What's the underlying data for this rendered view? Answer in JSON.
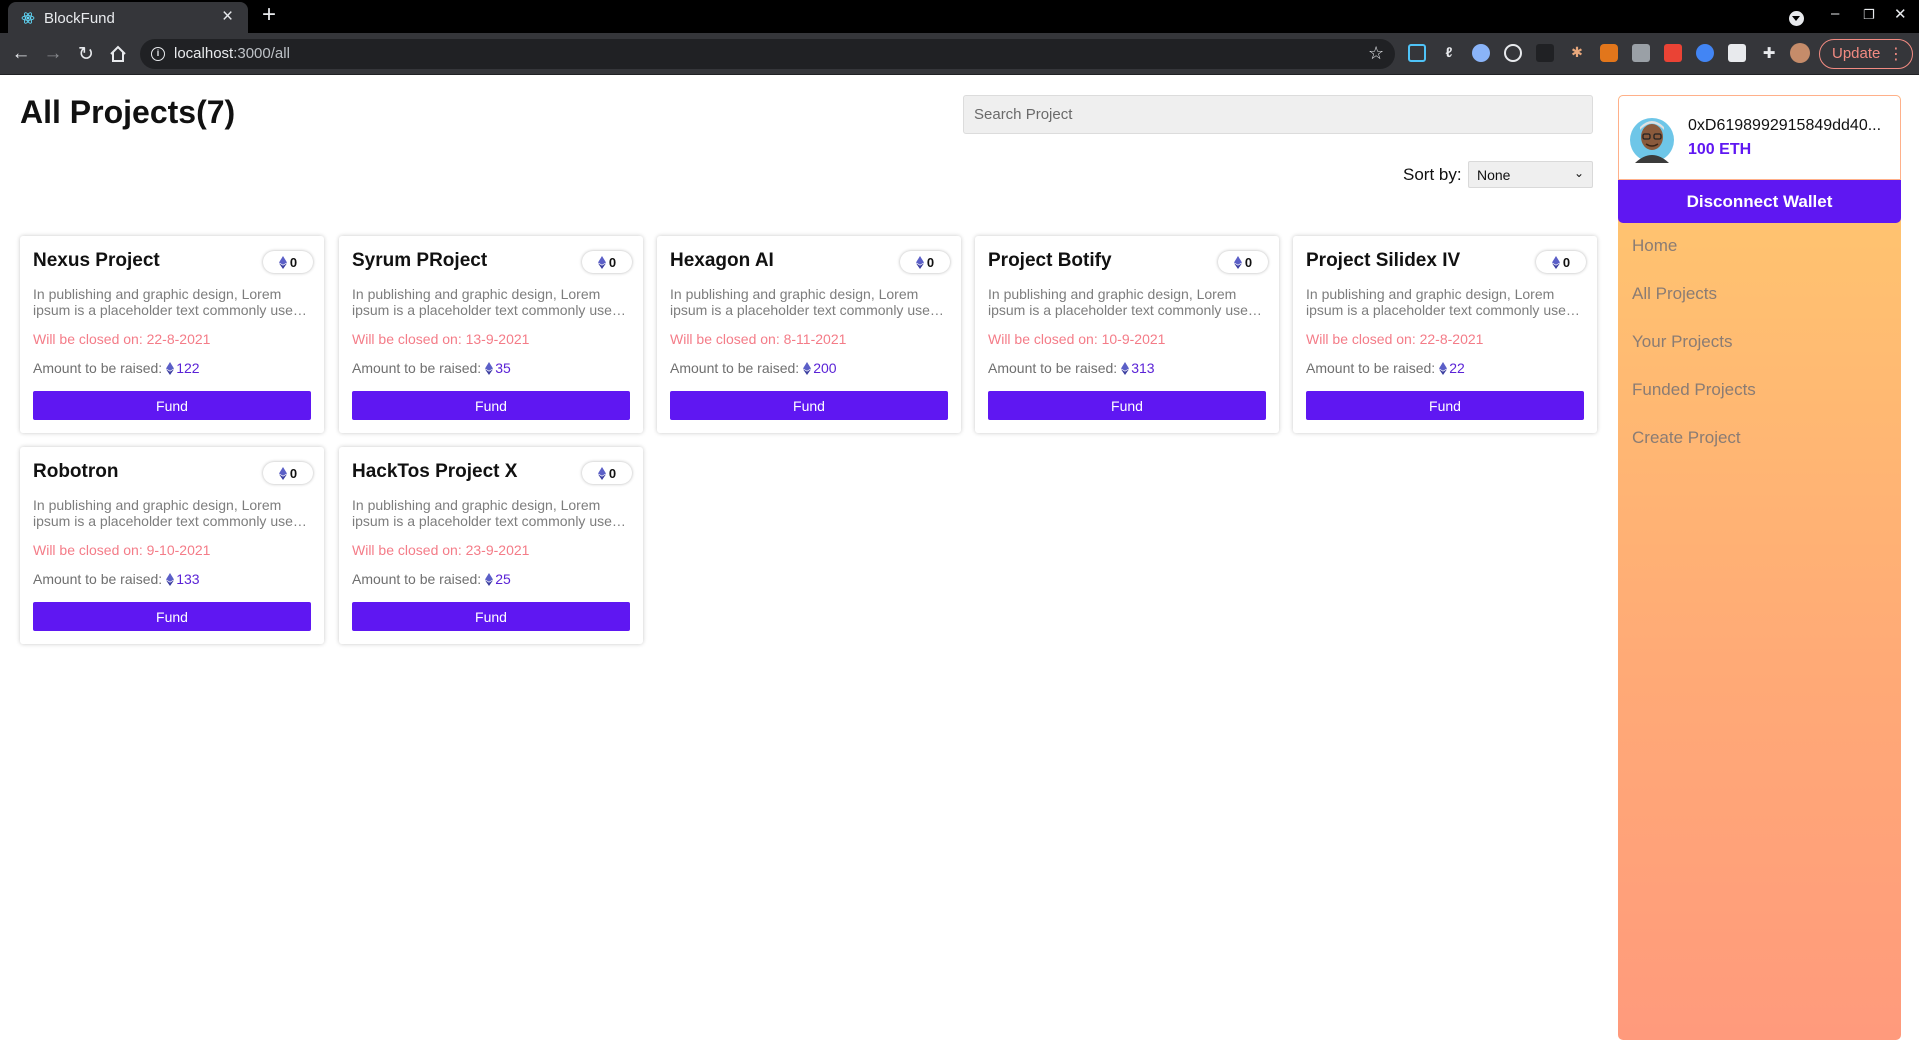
{
  "browser": {
    "tab_title": "BlockFund",
    "url_host": "localhost",
    "url_path": ":3000/all",
    "update_label": "Update"
  },
  "page": {
    "title": "All Projects(7)",
    "search_placeholder": "Search Project",
    "sort_label": "Sort by:",
    "sort_value": "None"
  },
  "projects": [
    {
      "name": "Nexus Project",
      "badge": "0",
      "description": "In publishing and graphic design, Lorem ipsum is a placeholder text commonly used to demonstrate the visual form of a document",
      "closing": "Will be closed on: 22-8-2021",
      "amount_label": "Amount to be raised:",
      "amount": "122",
      "button": "Fund"
    },
    {
      "name": "Syrum PRoject",
      "badge": "0",
      "description": "In publishing and graphic design, Lorem ipsum is a placeholder text commonly used to demonstrate the visual form of a document",
      "closing": "Will be closed on: 13-9-2021",
      "amount_label": "Amount to be raised:",
      "amount": "35",
      "button": "Fund"
    },
    {
      "name": "Hexagon AI",
      "badge": "0",
      "description": "In publishing and graphic design, Lorem ipsum is a placeholder text commonly used to demonstrate the visual form of a document",
      "closing": "Will be closed on: 8-11-2021",
      "amount_label": "Amount to be raised:",
      "amount": "200",
      "button": "Fund"
    },
    {
      "name": "Project Botify",
      "badge": "0",
      "description": "In publishing and graphic design, Lorem ipsum is a placeholder text commonly used to demonstrate the visual form of a document",
      "closing": "Will be closed on: 10-9-2021",
      "amount_label": "Amount to be raised:",
      "amount": "313",
      "button": "Fund"
    },
    {
      "name": "Project Silidex IV",
      "badge": "0",
      "description": "In publishing and graphic design, Lorem ipsum is a placeholder text commonly used to demonstrate the visual form of a document",
      "closing": "Will be closed on: 22-8-2021",
      "amount_label": "Amount to be raised:",
      "amount": "22",
      "button": "Fund"
    },
    {
      "name": "Robotron",
      "badge": "0",
      "description": "In publishing and graphic design, Lorem ipsum is a placeholder text commonly used to demonstrate the visual form of a document",
      "closing": "Will be closed on: 9-10-2021",
      "amount_label": "Amount to be raised:",
      "amount": "133",
      "button": "Fund"
    },
    {
      "name": "HackTos Project X",
      "badge": "0",
      "description": "In publishing and graphic design, Lorem ipsum is a placeholder text commonly used to demonstrate the visual form of a document",
      "closing": "Will be closed on: 23-9-2021",
      "amount_label": "Amount to be raised:",
      "amount": "25",
      "button": "Fund"
    }
  ],
  "sidebar": {
    "wallet_address": "0xD6198992915849dd40...",
    "balance": "100 ETH",
    "disconnect_label": "Disconnect Wallet",
    "nav": [
      "Home",
      "All Projects",
      "Your Projects",
      "Funded Projects",
      "Create Project"
    ]
  },
  "colors": {
    "accent": "#5f17f2",
    "closing_text": "#f47c88",
    "sidebar_gradient_top": "#ffca6e",
    "sidebar_gradient_bottom": "#ff9a7c"
  }
}
